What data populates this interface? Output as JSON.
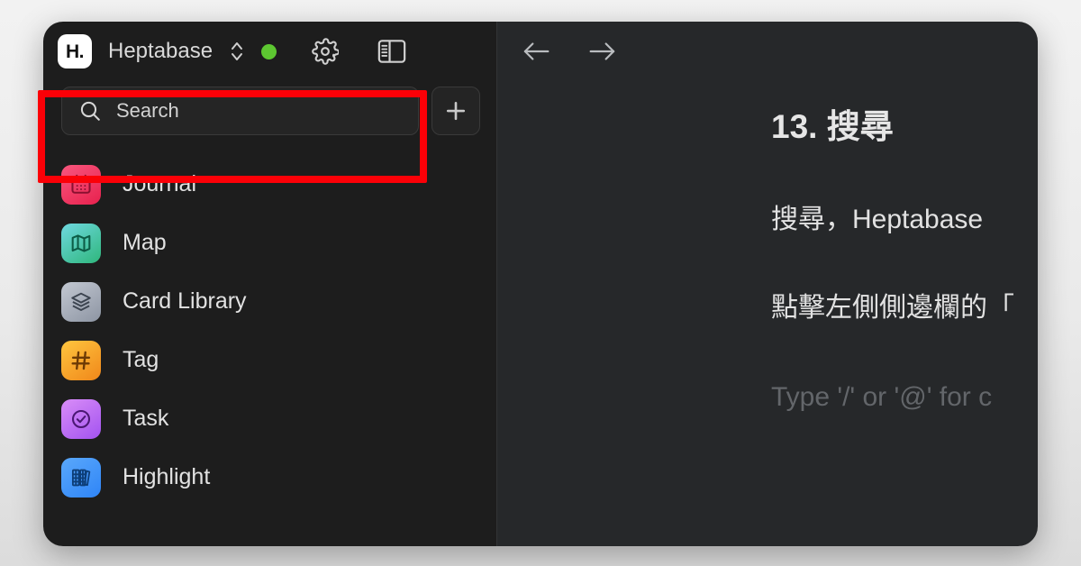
{
  "window": {
    "sidebar": {
      "brand": {
        "logo_text": "H.",
        "logo_icon": "heptabase-logo-icon",
        "name": "Heptabase",
        "switcher_icon": "chevron-up-down-icon",
        "status_icon": "status-dot-icon",
        "status_color": "#5dc731",
        "settings_icon": "gear-icon",
        "panel_toggle_icon": "sidebar-panel-icon"
      },
      "search": {
        "icon": "search-icon",
        "placeholder": "Search",
        "value": ""
      },
      "add_button": {
        "icon": "plus-icon",
        "label": "+"
      },
      "items": [
        {
          "label": "Journal",
          "icon": "calendar-icon",
          "color_start": "#f8577e",
          "color_end": "#e8214e"
        },
        {
          "label": "Map",
          "icon": "map-icon",
          "color_start": "#6fd8e0",
          "color_end": "#2fb77c"
        },
        {
          "label": "Card Library",
          "icon": "layers-icon",
          "color_start": "#b9bec9",
          "color_end": "#8d95a3"
        },
        {
          "label": "Tag",
          "icon": "hash-icon",
          "color_start": "#ffc43d",
          "color_end": "#f08a1c"
        },
        {
          "label": "Task",
          "icon": "check-circle-icon",
          "color_start": "#d07bf5",
          "color_end": "#a353f0"
        },
        {
          "label": "Highlight",
          "icon": "books-icon",
          "color_start": "#5aa8fb",
          "color_end": "#2f85f7"
        }
      ]
    },
    "main": {
      "toolbar": {
        "back_icon": "arrow-left-icon",
        "forward_icon": "arrow-right-icon"
      },
      "document": {
        "title": "13. 搜尋",
        "paragraphs": [
          "搜尋，Heptabase",
          "點擊左側側邊欄的「"
        ],
        "placeholder": "Type '/' or '@' for c"
      }
    }
  },
  "annotation": {
    "highlight_color": "#fb0007",
    "target": "search-box"
  }
}
